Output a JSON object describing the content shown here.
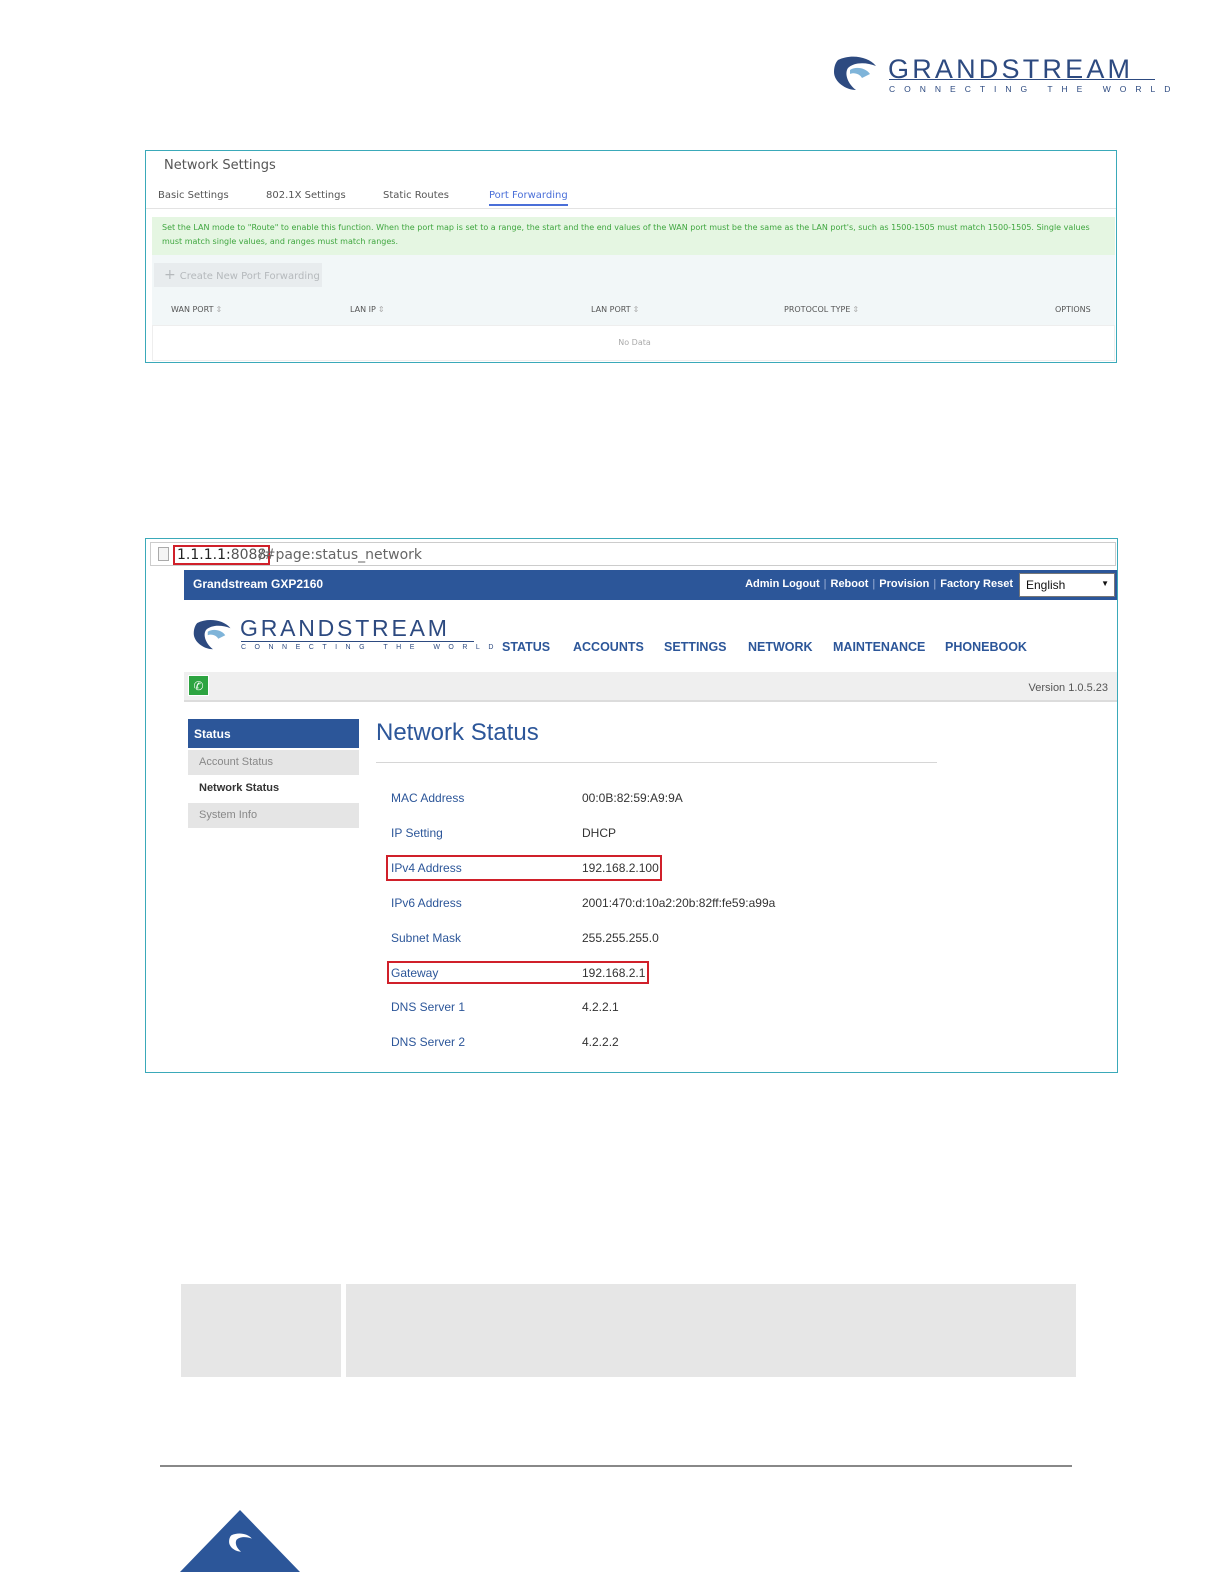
{
  "header_logo": {
    "name": "GRANDSTREAM",
    "tagline": "CONNECTING THE WORLD"
  },
  "network_settings": {
    "title": "Network Settings",
    "tabs": [
      "Basic Settings",
      "802.1X Settings",
      "Static Routes",
      "Port Forwarding"
    ],
    "active_tab": "Port Forwarding",
    "notice": "Set the LAN mode to \"Route\" to enable this function. When the port map is set to a range, the start and the end values of the WAN port must be the same as the LAN port's, such as 1500-1505 must match 1500-1505. Single values must match single values, and ranges must match ranges.",
    "create_button": "Create New Port Forwarding",
    "columns": [
      "WAN PORT",
      "LAN IP",
      "LAN PORT",
      "PROTOCOL TYPE",
      "OPTIONS"
    ],
    "empty_text": "No Data"
  },
  "browser": {
    "host": "1.1.1.1:",
    "port": "8088",
    "hash": "/#page:status_network"
  },
  "gxp": {
    "model": "Grandstream GXP2160",
    "top_links": [
      "Admin Logout",
      "Reboot",
      "Provision",
      "Factory Reset"
    ],
    "language": "English",
    "logo": {
      "name": "GRANDSTREAM",
      "tagline": "CONNECTING THE WORLD"
    },
    "nav": [
      "STATUS",
      "ACCOUNTS",
      "SETTINGS",
      "NETWORK",
      "MAINTENANCE",
      "PHONEBOOK"
    ],
    "version": "Version 1.0.5.23",
    "sidebar": {
      "header": "Status",
      "items": [
        "Account Status",
        "Network Status",
        "System Info"
      ]
    },
    "page_title": "Network Status",
    "rows": [
      {
        "label": "MAC Address",
        "value": "00:0B:82:59:A9:9A"
      },
      {
        "label": "IP Setting",
        "value": "DHCP"
      },
      {
        "label": "IPv4 Address",
        "value": "192.168.2.100"
      },
      {
        "label": "IPv6 Address",
        "value": "2001:470:d:10a2:20b:82ff:fe59:a99a"
      },
      {
        "label": "Subnet Mask",
        "value": "255.255.255.0"
      },
      {
        "label": "Gateway",
        "value": "192.168.2.1"
      },
      {
        "label": "DNS Server 1",
        "value": "4.2.2.1"
      },
      {
        "label": "DNS Server 2",
        "value": "4.2.2.2"
      }
    ]
  },
  "colors": {
    "brand_blue": "#2c5699",
    "highlight_red": "#d0202a",
    "frame_teal": "#3aa9b9",
    "notice_green": "#3fa63f"
  }
}
